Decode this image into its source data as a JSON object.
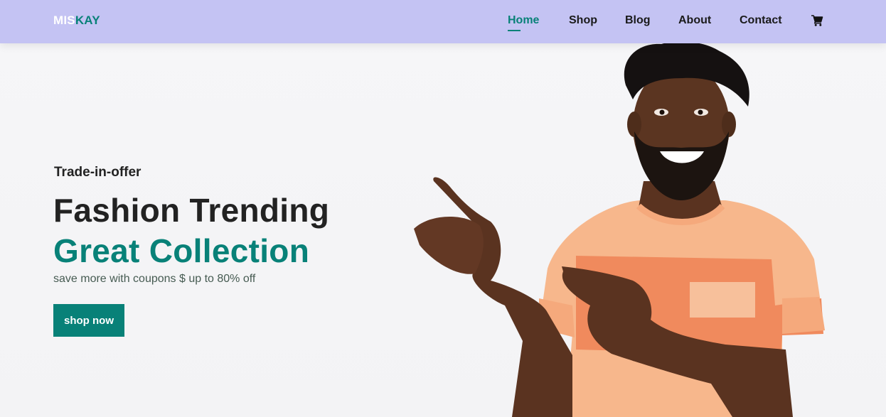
{
  "brand": {
    "part1": "MIS",
    "part2": "KAY"
  },
  "nav": {
    "items": [
      {
        "label": "Home",
        "active": true
      },
      {
        "label": "Shop",
        "active": false
      },
      {
        "label": "Blog",
        "active": false
      },
      {
        "label": "About",
        "active": false
      },
      {
        "label": "Contact",
        "active": false
      }
    ],
    "cart_icon": "cart-icon"
  },
  "hero": {
    "eyebrow": "Trade-in-offer",
    "headline": "Fashion Trending",
    "headline_accent": "Great Collection",
    "subtext": "save more with coupons $ up to 80% off",
    "cta_label": "shop now",
    "image": "smiling-man-pointing"
  },
  "colors": {
    "accent": "#088178",
    "navbar_bg": "#c4c3f3",
    "text_dark": "#222222",
    "shirt": "#f7b78c",
    "shirt_stripe": "#f08a5d"
  }
}
